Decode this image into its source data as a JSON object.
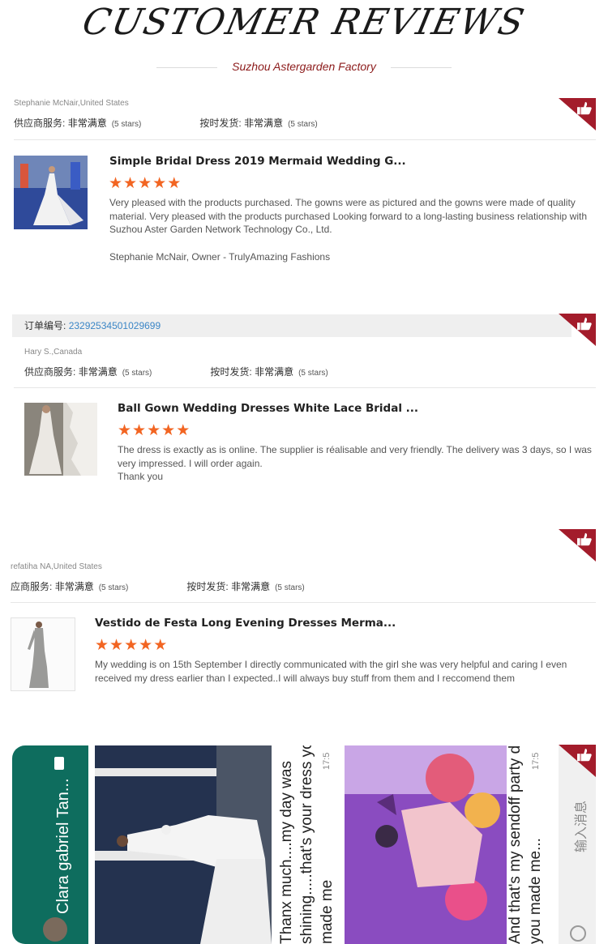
{
  "header": {
    "title": "CUSTOMER REVIEWS",
    "subtitle": "Suzhou Astergarden Factory"
  },
  "colors": {
    "accent": "#a31c2b",
    "stars": "#f26522",
    "link": "#3b86c6"
  },
  "reviews": [
    {
      "reviewer": "Stephanie McNair,United States",
      "service_label": "供应商服务:",
      "service_value": "非常满意",
      "service_stars": "(5 stars)",
      "delivery_label": "按时发货:",
      "delivery_value": "非常满意",
      "delivery_stars": "(5 stars)",
      "product_title": "Simple Bridal Dress 2019 Mermaid Wedding G...",
      "rating": 5,
      "text": "Very pleased with the products purchased. The gowns were as pictured and the gowns were made of quality material.  Very pleased with the products purchased Looking forward to a long-lasting business relationship with Suzhou Aster Garden Network Technology Co., Ltd.",
      "signature": "Stephanie McNair, Owner - TrulyAmazing Fashions"
    },
    {
      "order_label": "订单编号:",
      "order_number": "23292534501029699",
      "reviewer": "Hary S.,Canada",
      "service_label": "供应商服务:",
      "service_value": "非常满意",
      "service_stars": "(5 stars)",
      "delivery_label": "按时发货:",
      "delivery_value": "非常满意",
      "delivery_stars": "(5 stars)",
      "product_title": "Ball Gown Wedding Dresses White Lace Bridal ...",
      "rating": 5,
      "text": "The dress is exactly as is online. The supplier is réalisable and very friendly. The delivery was 3 days, so I was very impressed. I will order again.",
      "text2": "Thank you"
    },
    {
      "reviewer": "refatiha NA,United States",
      "service_label": "应商服务:",
      "service_value": "非常满意",
      "service_stars": "(5 stars)",
      "delivery_label": "按时发货:",
      "delivery_value": "非常满意",
      "delivery_stars": "(5 stars)",
      "product_title": "Vestido de Festa Long Evening Dresses Merma...",
      "rating": 5,
      "text": "My wedding is on 15th September I directly communicated with the girl she was very helpful and caring I even received my dress earlier than I expected..I will always buy stuff from them and I reccomend them"
    }
  ],
  "chat_screenshot": {
    "contact": "Clara gabriel Tan...",
    "message1_line1": "Thanx much....my day was",
    "message1_line2": "shining.....that's your dress you",
    "message1_line3": "made me",
    "message2_line1": "And that's my sendoff party dress",
    "message2_line2": "you  made me...",
    "input_placeholder": "输入消息",
    "time1": "17:5",
    "time2": "17:5"
  },
  "icons": {
    "badge": "thumbs-up-icon",
    "star": "star-icon"
  }
}
